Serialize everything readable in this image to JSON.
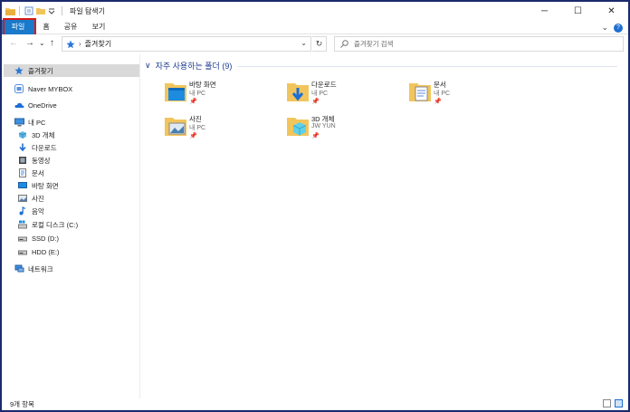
{
  "window": {
    "title": "파일 탐색기",
    "controls": {
      "minimize": "─",
      "maximize": "☐",
      "close": "✕"
    }
  },
  "ribbon": {
    "tabs": [
      "파일",
      "홈",
      "공유",
      "보기"
    ],
    "active_tab": "파일",
    "expand_glyph": "⌄",
    "help_glyph": "?"
  },
  "nav": {
    "back": "←",
    "forward": "→",
    "recent": "⌄",
    "up": "↑",
    "address_path": "즐겨찾기",
    "address_sep": "›",
    "dropdown": "⌄",
    "refresh": "↻",
    "search_placeholder": "즐겨찾기 검색"
  },
  "sidebar": {
    "quick_access": "즐겨찾기",
    "naver": "Naver MYBOX",
    "onedrive": "OneDrive",
    "this_pc": "내 PC",
    "pc_items": [
      "3D 개체",
      "다운로드",
      "동영상",
      "문서",
      "바탕 화면",
      "사진",
      "음악",
      "로컬 디스크 (C:)",
      "SSD (D:)",
      "HDD (E:)"
    ],
    "network": "네트워크"
  },
  "content": {
    "group_chevron": "∨",
    "group_title": "자주 사용하는 폴더 (9)",
    "pin_glyph": "📌",
    "tiles": [
      {
        "name": "바탕 화면",
        "location": "내 PC"
      },
      {
        "name": "다운로드",
        "location": "내 PC"
      },
      {
        "name": "문서",
        "location": "내 PC"
      },
      {
        "name": "사진",
        "location": "내 PC"
      },
      {
        "name": "3D 개체",
        "location": "JW YUN"
      }
    ]
  },
  "status": {
    "item_count": "9개 항목"
  },
  "colors": {
    "accent": "#1979ca",
    "highlight": "#d61b1b",
    "folder": "#f2c55c",
    "group_title": "#1e3b8f"
  }
}
